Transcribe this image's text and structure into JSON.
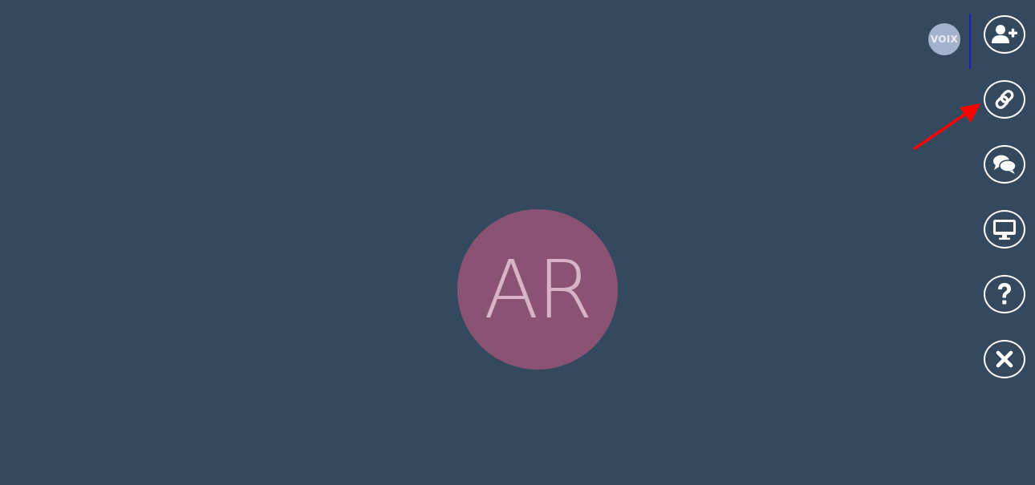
{
  "participant": {
    "initials": "AR"
  },
  "voix_badge": {
    "label": "VOIX"
  },
  "toolbar": {
    "buttons": [
      {
        "name": "add-participant",
        "icon": "user-plus-icon"
      },
      {
        "name": "share-link",
        "icon": "link-icon"
      },
      {
        "name": "chat",
        "icon": "chat-bubbles-icon"
      },
      {
        "name": "screen-share",
        "icon": "monitor-icon"
      },
      {
        "name": "help",
        "icon": "question-icon"
      },
      {
        "name": "close",
        "icon": "close-x-icon"
      }
    ]
  },
  "colors": {
    "background": "#34495e",
    "avatar": "#8a5273",
    "avatar_text": "#d8b2c6",
    "badge": "#a3b2cc",
    "button_border": "#ffffff",
    "annotation_arrow": "#ff0000"
  }
}
